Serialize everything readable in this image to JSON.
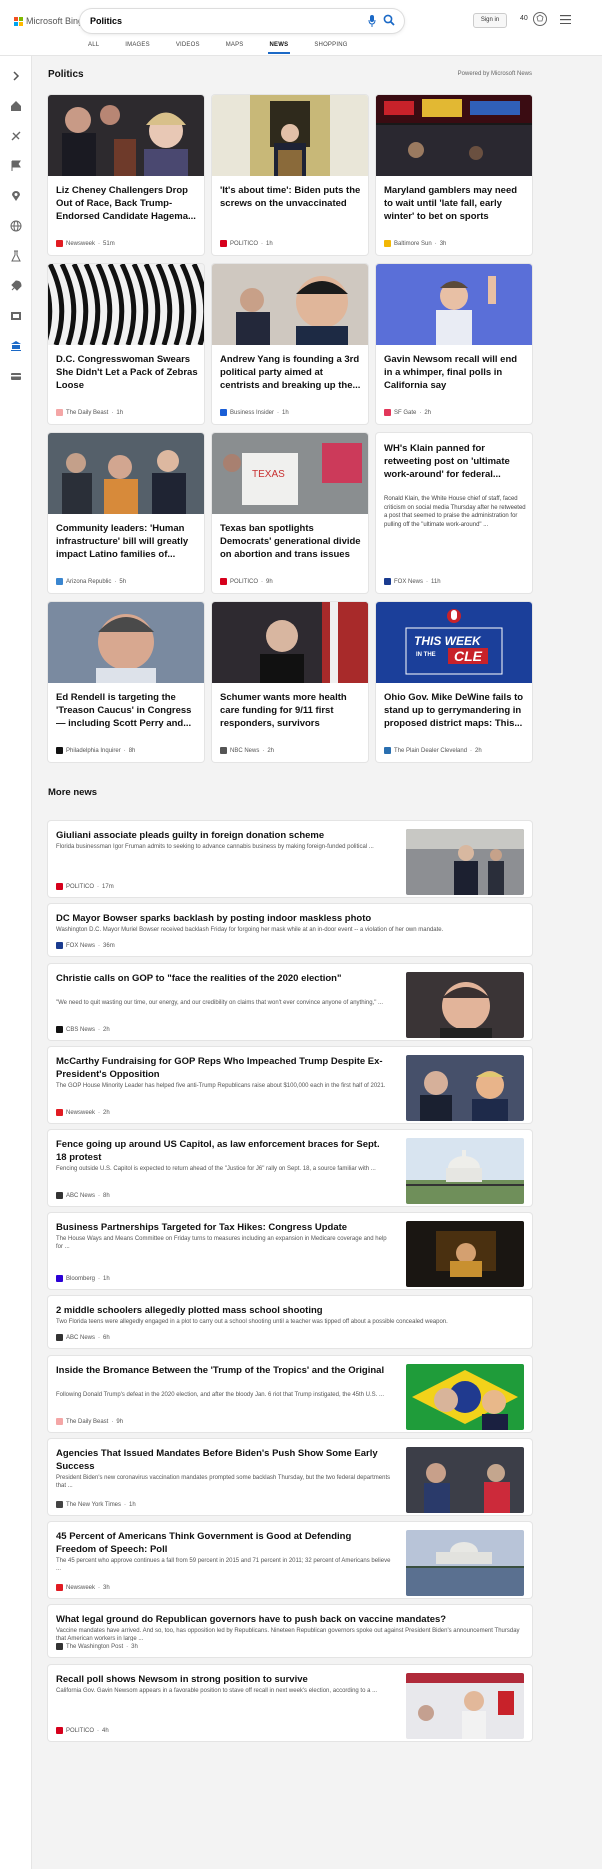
{
  "header": {
    "logo_text": "Microsoft Bing",
    "search_value": "Politics",
    "tabs": [
      "ALL",
      "IMAGES",
      "VIDEOS",
      "MAPS",
      "NEWS",
      "SHOPPING"
    ],
    "active_tab": "NEWS",
    "signin_label": "Sign in",
    "points": "40"
  },
  "sidebar_icons": [
    "chevron-right-icon",
    "home-icon",
    "sports-icon",
    "flag-icon",
    "location-pin-icon",
    "globe-icon",
    "science-icon",
    "rocket-icon",
    "film-icon",
    "bank-icon",
    "card-icon"
  ],
  "section": {
    "title": "Politics",
    "powered_by": "Powered by Microsoft News"
  },
  "cards": [
    {
      "title": "Liz Cheney Challengers Drop Out of Race, Back Trump-Endorsed Candidate Hagema...",
      "source": "Newsweek",
      "time": "51m",
      "source_color": "#e11b22"
    },
    {
      "title": "'It's about time': Biden puts the screws on the unvaccinated",
      "source": "POLITICO",
      "time": "1h",
      "source_color": "#d6001c"
    },
    {
      "title": "Maryland gamblers may need to wait until 'late fall, early winter' to bet on sports",
      "source": "Baltimore Sun",
      "time": "3h",
      "source_color": "#f2b705"
    },
    {
      "title": "D.C. Congresswoman Swears She Didn't Let a Pack of Zebras Loose",
      "source": "The Daily Beast",
      "time": "1h",
      "source_color": "#f4a6a6"
    },
    {
      "title": "Andrew Yang is founding a 3rd political party aimed at centrists and breaking up the...",
      "source": "Business Insider",
      "time": "1h",
      "source_color": "#1a5ed6"
    },
    {
      "title": "Gavin Newsom recall will end in a whimper, final polls in California say",
      "source": "SF Gate",
      "time": "2h",
      "source_color": "#e2375a"
    },
    {
      "title": "Community leaders: 'Human infrastructure' bill will greatly impact Latino families of...",
      "source": "Arizona Republic",
      "time": "5h",
      "source_color": "#3a86d0"
    },
    {
      "title": "Texas ban spotlights Democrats' generational divide on abortion and trans issues",
      "source": "POLITICO",
      "time": "9h",
      "source_color": "#d6001c"
    },
    {
      "title": "WH's Klain panned for retweeting post on 'ultimate work-around' for federal...",
      "description": "Ronald Klain, the White House chief of staff, faced criticism on social media Thursday after he retweeted a post that seemed to praise the administration for pulling off the \"ultimate work-around\" ...",
      "source": "FOX News",
      "time": "11h",
      "source_color": "#1a3b8f"
    },
    {
      "title": "Ed Rendell is targeting the 'Treason Caucus' in Congress — including Scott Perry and...",
      "source": "Philadelphia Inquirer",
      "time": "8h",
      "source_color": "#111111"
    },
    {
      "title": "Schumer wants more health care funding for 9/11 first responders, survivors",
      "source": "NBC News",
      "time": "2h",
      "source_color": "#555555"
    },
    {
      "title": "Ohio Gov. Mike DeWine fails to stand up to gerrymandering in proposed district maps: This...",
      "source": "The Plain Dealer Cleveland",
      "time": "2h",
      "source_color": "#2a6fb0"
    }
  ],
  "banner": {
    "line1": "THIS WEEK",
    "line2": "IN THE",
    "line3": "CLE"
  },
  "more_news": {
    "title": "More news",
    "items": [
      {
        "title": "Giuliani associate pleads guilty in foreign donation scheme",
        "description": "Florida businessman Igor Fruman admits to seeking to advance cannabis business by making foreign-funded political ...",
        "source": "POLITICO",
        "time": "17m",
        "source_color": "#d6001c"
      },
      {
        "title": "DC Mayor Bowser sparks backlash by posting indoor maskless photo",
        "description": "Washington D.C. Mayor Muriel Bowser received backlash Friday for forgoing her mask while at an in-door event -- a violation of her own mandate.",
        "source": "FOX News",
        "time": "36m",
        "source_color": "#1a3b8f"
      },
      {
        "title": "Christie calls on GOP to \"face the realities of the 2020 election\"",
        "description": "\"We need to quit wasting our time, our energy, and our credibility on claims that won't ever convince anyone of anything,\" ...",
        "source": "CBS News",
        "time": "2h",
        "source_color": "#111111"
      },
      {
        "title": "McCarthy Fundraising for GOP Reps Who Impeached Trump Despite Ex-President's Opposition",
        "description": "The GOP House Minority Leader has helped five anti-Trump Republicans raise about $100,000 each in the first half of 2021.",
        "source": "Newsweek",
        "time": "2h",
        "source_color": "#e11b22"
      },
      {
        "title": "Fence going up around US Capitol, as law enforcement braces for Sept. 18 protest",
        "description": "Fencing outside U.S. Capitol is expected to return ahead of the \"Justice for J6\" rally on Sept. 18, a source familiar with ...",
        "source": "ABC News",
        "time": "8h",
        "source_color": "#333333"
      },
      {
        "title": "Business Partnerships Targeted for Tax Hikes: Congress Update",
        "description": "The House Ways and Means Committee on Friday turns to measures including an expansion in Medicare coverage and help for ...",
        "source": "Bloomberg",
        "time": "1h",
        "source_color": "#2b00d6"
      },
      {
        "title": "2 middle schoolers allegedly plotted mass school shooting",
        "description": "Two Florida teens were allegedly engaged in a plot to carry out a school shooting until a teacher was tipped off about a possible concealed weapon.",
        "source": "ABC News",
        "time": "6h",
        "source_color": "#333333"
      },
      {
        "title": "Inside the Bromance Between the 'Trump of the Tropics' and the Original",
        "description": "Following Donald Trump's defeat in the 2020 election, and after the bloody Jan. 6 riot that Trump instigated, the 45th U.S. ...",
        "source": "The Daily Beast",
        "time": "9h",
        "source_color": "#f4a6a6"
      },
      {
        "title": "Agencies That Issued Mandates Before Biden's Push Show Some Early Success",
        "description": "President Biden's new coronavirus vaccination mandates prompted some backlash Thursday, but the two federal departments that ...",
        "source": "The New York Times",
        "time": "1h",
        "source_color": "#444444"
      },
      {
        "title": "45 Percent of Americans Think Government is Good at Defending Freedom of Speech: Poll",
        "description": "The 45 percent who approve continues a fall from 59 percent in 2015 and 71 percent in 2011; 32 percent of Americans believe ...",
        "source": "Newsweek",
        "time": "3h",
        "source_color": "#e11b22"
      },
      {
        "title": "What legal ground do Republican governors have to push back on vaccine mandates?",
        "description": "Vaccine mandates have arrived. And so, too, has opposition led by Republicans. Nineteen Republican governors spoke out against President Biden's announcement Thursday that American workers in large ...",
        "source": "The Washington Post",
        "time": "3h",
        "source_color": "#333333"
      },
      {
        "title": "Recall poll shows Newsom in strong position to survive",
        "description": "California Gov. Gavin Newsom appears in a favorable position to stave off recall in next week's election, according to a ...",
        "source": "POLITICO",
        "time": "4h",
        "source_color": "#d6001c"
      }
    ]
  }
}
